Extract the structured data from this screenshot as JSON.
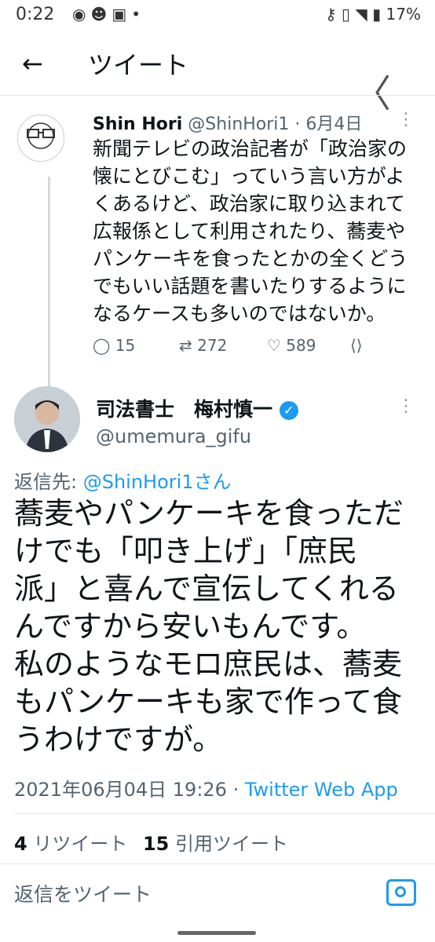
{
  "status_bar": {
    "time": "0:22",
    "left_icons": [
      "messenger-icon",
      "discord-icon",
      "game-icon",
      "dot-icon"
    ],
    "right_icons": [
      "key-icon",
      "vibrate-icon",
      "wifi-icon",
      "battery-icon"
    ],
    "battery": "17%"
  },
  "header": {
    "back_icon": "back-arrow-icon",
    "title": "ツイート",
    "chevron_icon": "chevron-left-icon"
  },
  "quoted_tweet": {
    "name": "Shin Hori",
    "handle": "@ShinHori1",
    "date": "· 6月4日",
    "text_lines": [
      "新聞テレビの政治記者が「政治家の",
      "懐にとびこむ」っていう言い方がよ",
      "くあるけど、政治家に取り込まれて",
      "広報係として利用されたり、蕎麦や",
      "パンケーキを食ったとかの全くどう",
      "でもいい話題を書いたりするように",
      "なるケースも多いのではないか。"
    ],
    "replies": "15",
    "retweets": "272",
    "likes": "589"
  },
  "main_tweet": {
    "name": "司法書士　梅村慎一",
    "handle": "@umemura_gifu",
    "reply_prefix": "返信先:",
    "reply_to": "@ShinHori1さん",
    "text_lines": [
      "蕎麦やパンケーキを食っただ",
      "けでも「叩き上げ」「庶民",
      "派」と喜んで宣伝してくれる",
      "んですから安いもんです。",
      "私のようなモロ庶民は、蕎麦",
      "もパンケーキも家で作って食",
      "うわけですが。"
    ],
    "timestamp": "2021年06月04日 19:26 ·",
    "source": "Twitter Web App",
    "retweet_count": "4",
    "retweet_label": "リツイート",
    "quote_count": "15",
    "quote_label": "引用ツイート"
  },
  "reply_input": {
    "placeholder": "返信をツイート"
  }
}
